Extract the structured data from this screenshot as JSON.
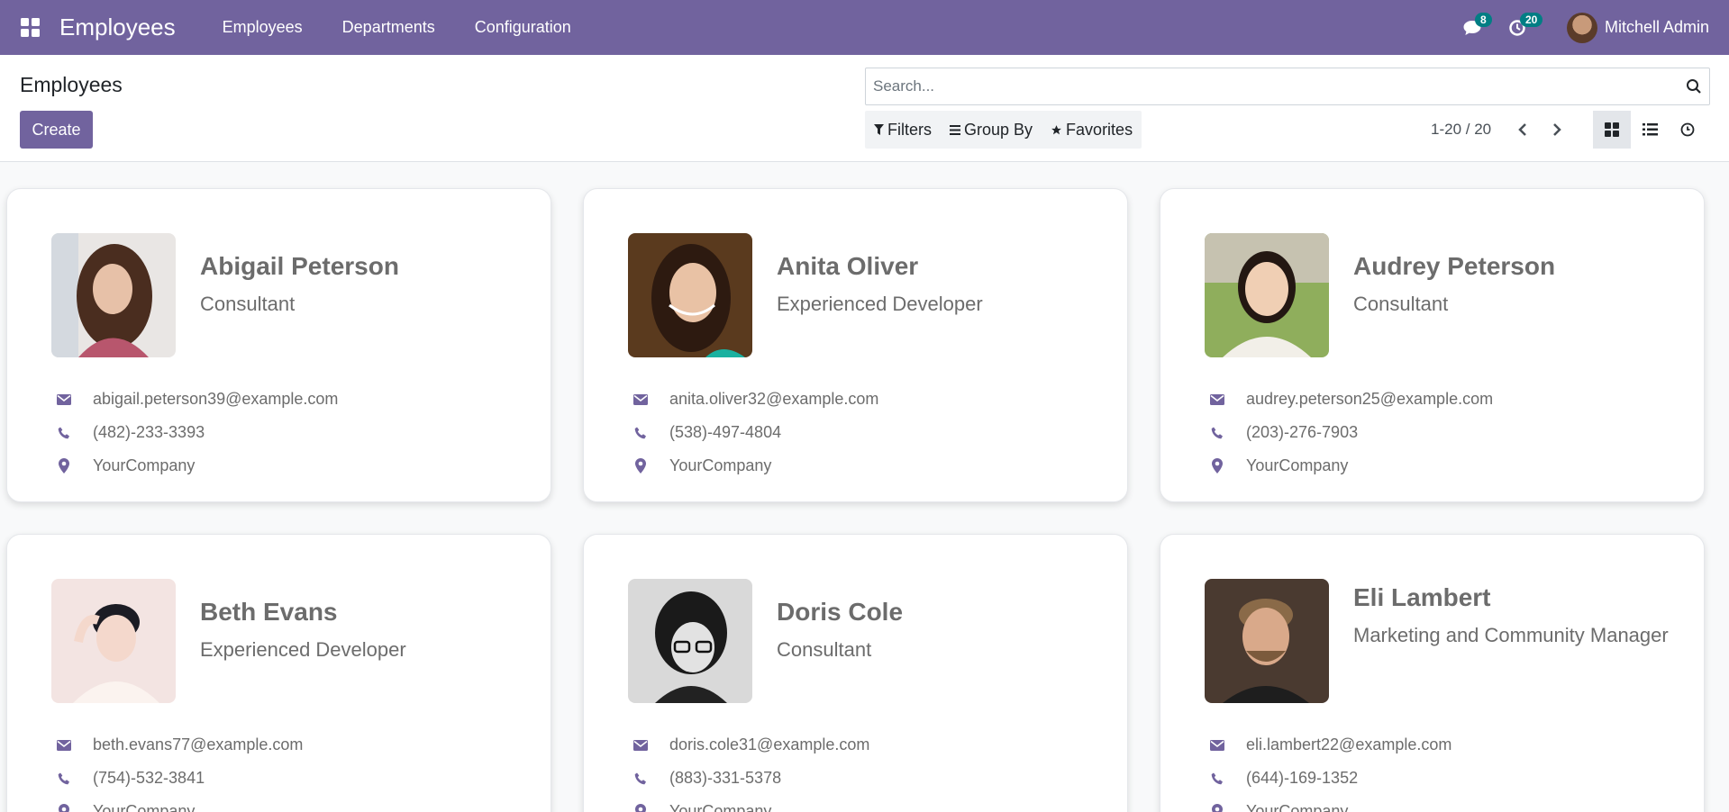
{
  "navbar": {
    "brand": "Employees",
    "menu": [
      "Employees",
      "Departments",
      "Configuration"
    ],
    "messages_count": "8",
    "activities_count": "20",
    "user_name": "Mitchell Admin"
  },
  "control_panel": {
    "title": "Employees",
    "create_label": "Create",
    "search_placeholder": "Search...",
    "filters_label": "Filters",
    "group_by_label": "Group By",
    "favorites_label": "Favorites",
    "pager_value": "1-20 / 20"
  },
  "employees": [
    {
      "name": "Abigail Peterson",
      "job": "Consultant",
      "email": "abigail.peterson39@example.com",
      "phone": "(482)-233-3393",
      "company": "YourCompany"
    },
    {
      "name": "Anita Oliver",
      "job": "Experienced Developer",
      "email": "anita.oliver32@example.com",
      "phone": "(538)-497-4804",
      "company": "YourCompany"
    },
    {
      "name": "Audrey Peterson",
      "job": "Consultant",
      "email": "audrey.peterson25@example.com",
      "phone": "(203)-276-7903",
      "company": "YourCompany"
    },
    {
      "name": "Beth Evans",
      "job": "Experienced Developer",
      "email": "beth.evans77@example.com",
      "phone": "(754)-532-3841",
      "company": "YourCompany"
    },
    {
      "name": "Doris Cole",
      "job": "Consultant",
      "email": "doris.cole31@example.com",
      "phone": "(883)-331-5378",
      "company": "YourCompany"
    },
    {
      "name": "Eli Lambert",
      "job": "Marketing and Community Manager",
      "email": "eli.lambert22@example.com",
      "phone": "(644)-169-1352",
      "company": "YourCompany"
    }
  ],
  "colors": {
    "brand": "#71639e",
    "badge": "#017e84",
    "icon": "#71639e"
  }
}
